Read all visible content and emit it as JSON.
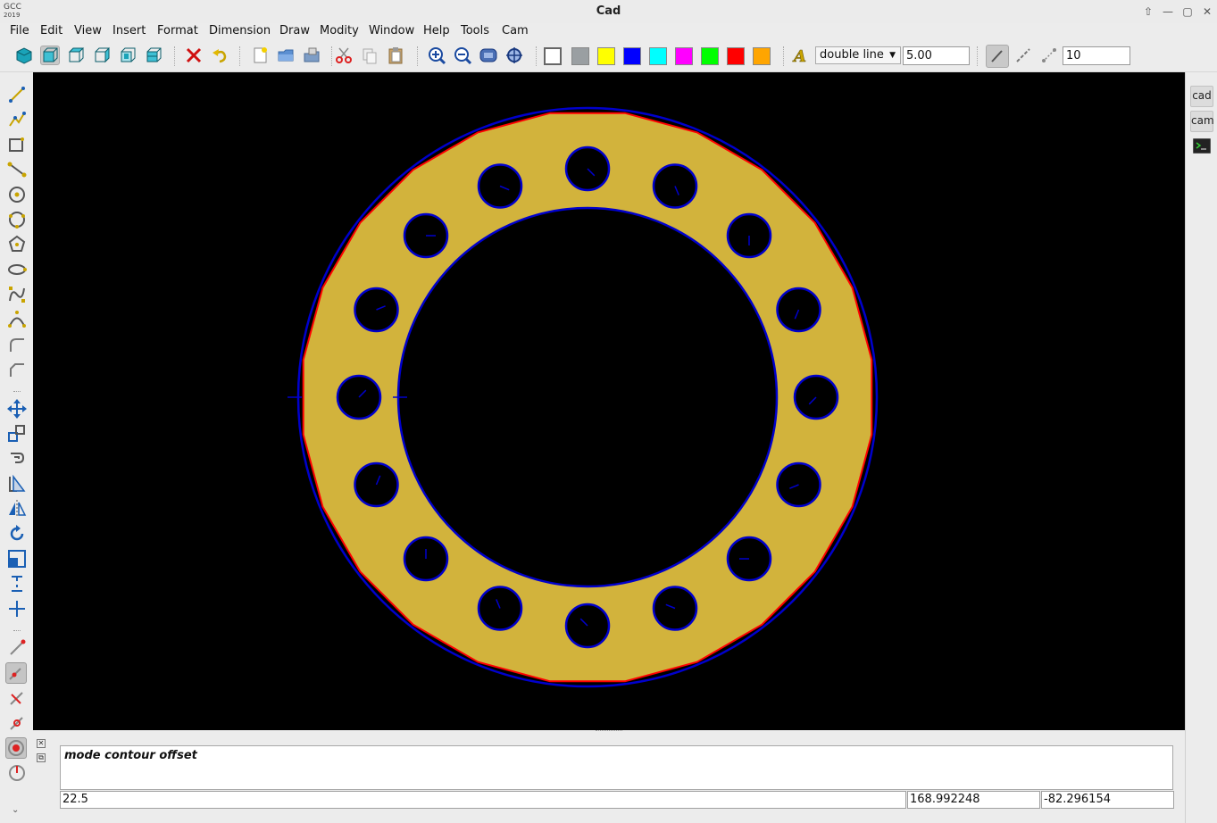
{
  "window": {
    "logo_line1": "GCC",
    "logo_line2": "2019",
    "title": "Cad",
    "controls": {
      "up": "⇧",
      "minimize": "—",
      "maximize": "▢",
      "close": "✕"
    }
  },
  "menu": [
    "File",
    "Edit",
    "View",
    "Insert",
    "Format",
    "Dimension",
    "Draw",
    "Modity",
    "Window",
    "Help",
    "Tools",
    "Cam"
  ],
  "toolbar": {
    "view_icons": [
      "cube-solid-icon",
      "cube-front-icon",
      "cube-left-icon",
      "cube-right-icon",
      "cube-top-icon",
      "cube-iso-icon"
    ],
    "edit_icons": [
      "delete-icon",
      "undo-icon",
      "new-file-icon",
      "open-folder-icon",
      "save-as-icon",
      "cut-icon",
      "copy-icon",
      "paste-icon"
    ],
    "zoom_icons": [
      "zoom-in-icon",
      "zoom-out-icon",
      "zoom-window-icon",
      "zoom-extents-icon"
    ],
    "colors": [
      "#ffffff",
      "#9a9fa2",
      "#ffff00",
      "#0000ff",
      "#00ffff",
      "#ff00ff",
      "#00ff00",
      "#ff0000",
      "#ffa500"
    ],
    "text_style_icon": "text-style-icon",
    "line_type": "double line",
    "line_width": "5.00",
    "snap_value": "10"
  },
  "left_tools": [
    "line-icon",
    "polyline-icon",
    "rectangle-icon",
    "node-line-icon",
    "circle-icon",
    "circle-3p-icon",
    "polygon-icon",
    "ellipse-icon",
    "spline-icon",
    "bezier-icon",
    "fillet-icon",
    "chamfer-icon",
    "move-icon",
    "copy-move-icon",
    "offset-icon",
    "trim-icon",
    "mirror-icon",
    "rotate-icon",
    "scale-icon",
    "break-icon",
    "extend-icon",
    "measure-icon",
    "edit-pencil-icon",
    "cross-pencil-icon",
    "snap-pencil-icon",
    "contour-offset-icon",
    "circle-tool-icon"
  ],
  "right_panel": {
    "cad_tab": "cad",
    "cam_tab": "cam",
    "terminal_icon": "terminal-icon"
  },
  "drawing": {
    "fill_color": "#d2b33c",
    "outline_color": "#0000cc",
    "offset_color": "#ff0000",
    "hole_count": 16,
    "background": "#000000"
  },
  "command": {
    "output": "mode contour offset",
    "input": "22.5",
    "coord_x": "168.992248",
    "coord_y": "-82.296154"
  }
}
